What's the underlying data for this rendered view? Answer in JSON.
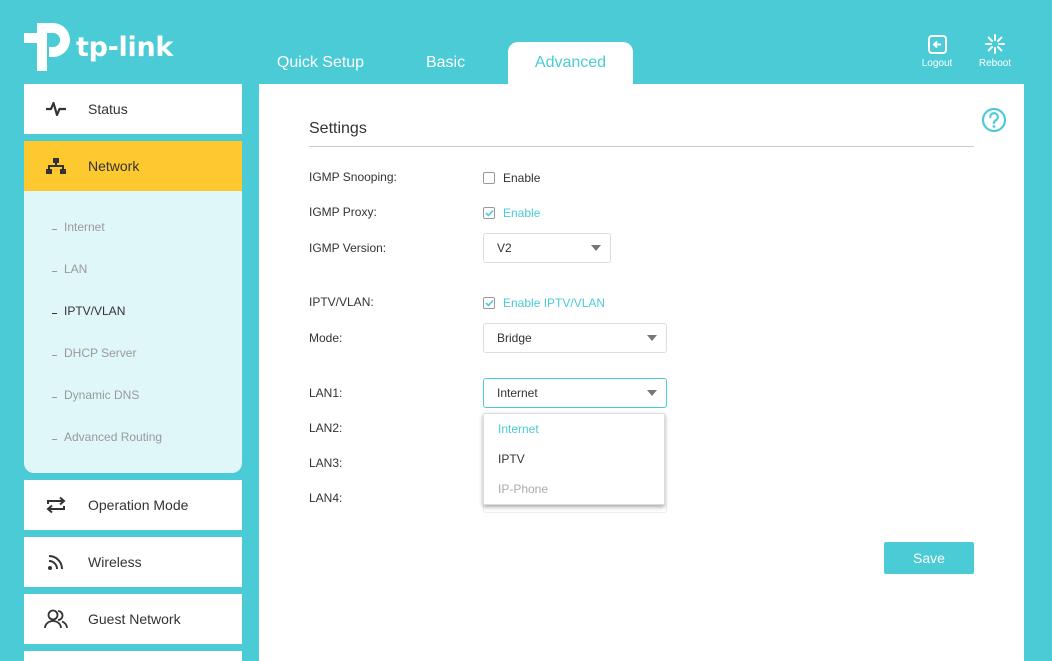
{
  "brand": {
    "logo_text": "tp-link"
  },
  "tabs": [
    {
      "label": "Quick Setup"
    },
    {
      "label": "Basic"
    },
    {
      "label": "Advanced"
    }
  ],
  "header_buttons": {
    "logout": "Logout",
    "reboot": "Reboot"
  },
  "sidebar": {
    "items": [
      {
        "label": "Status",
        "icon": "pulse-icon"
      },
      {
        "label": "Network",
        "icon": "network-icon"
      },
      {
        "label": "Operation Mode",
        "icon": "swap-icon"
      },
      {
        "label": "Wireless",
        "icon": "wifi-icon"
      },
      {
        "label": "Guest Network",
        "icon": "users-icon"
      }
    ],
    "network_submenu": [
      {
        "label": "Internet"
      },
      {
        "label": "LAN"
      },
      {
        "label": "IPTV/VLAN"
      },
      {
        "label": "DHCP Server"
      },
      {
        "label": "Dynamic DNS"
      },
      {
        "label": "Advanced Routing"
      }
    ]
  },
  "settings": {
    "title": "Settings",
    "igmp_snooping": {
      "label": "IGMP Snooping:",
      "option": "Enable",
      "checked": false
    },
    "igmp_proxy": {
      "label": "IGMP Proxy:",
      "option": "Enable",
      "checked": true
    },
    "igmp_version": {
      "label": "IGMP Version:",
      "value": "V2"
    },
    "iptv_vlan": {
      "label": "IPTV/VLAN:",
      "option": "Enable IPTV/VLAN",
      "checked": true
    },
    "mode": {
      "label": "Mode:",
      "value": "Bridge"
    },
    "lan1": {
      "label": "LAN1:",
      "value": "Internet"
    },
    "lan2": {
      "label": "LAN2:"
    },
    "lan3": {
      "label": "LAN3:"
    },
    "lan4": {
      "label": "LAN4:"
    },
    "lan1_options": [
      "Internet",
      "IPTV",
      "IP-Phone"
    ],
    "save_label": "Save"
  },
  "colors": {
    "accent": "#4acbd6",
    "active_menu": "#fdc92e",
    "submenu_bg": "#e0f7f9"
  }
}
